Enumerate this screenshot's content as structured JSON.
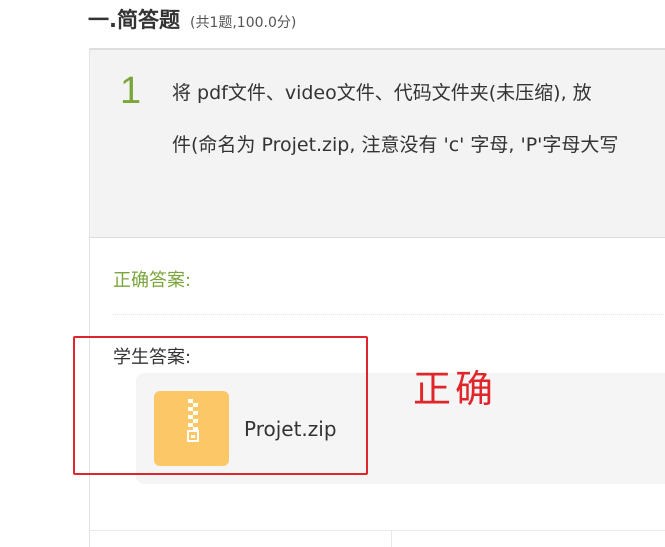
{
  "section": {
    "title": "一.简答题",
    "meta": "(共1题,100.0分)"
  },
  "question": {
    "number": "1",
    "text_line1": "将 pdf文件、video文件、代码文件夹(未压缩), 放",
    "text_line2": "件(命名为 Projet.zip, 注意没有 'c' 字母, 'P'字母大写"
  },
  "answer": {
    "correct_label": "正确答案:",
    "student_label": "学生答案:",
    "file": {
      "name": "Projet.zip",
      "icon": "zip-file-icon"
    }
  },
  "annotation": {
    "text": "正确"
  },
  "colors": {
    "accent_green": "#7aa53a",
    "annotation_red": "#e0252b",
    "zip_icon_orange": "#fcc766",
    "card_gray": "#f3f3f3"
  }
}
